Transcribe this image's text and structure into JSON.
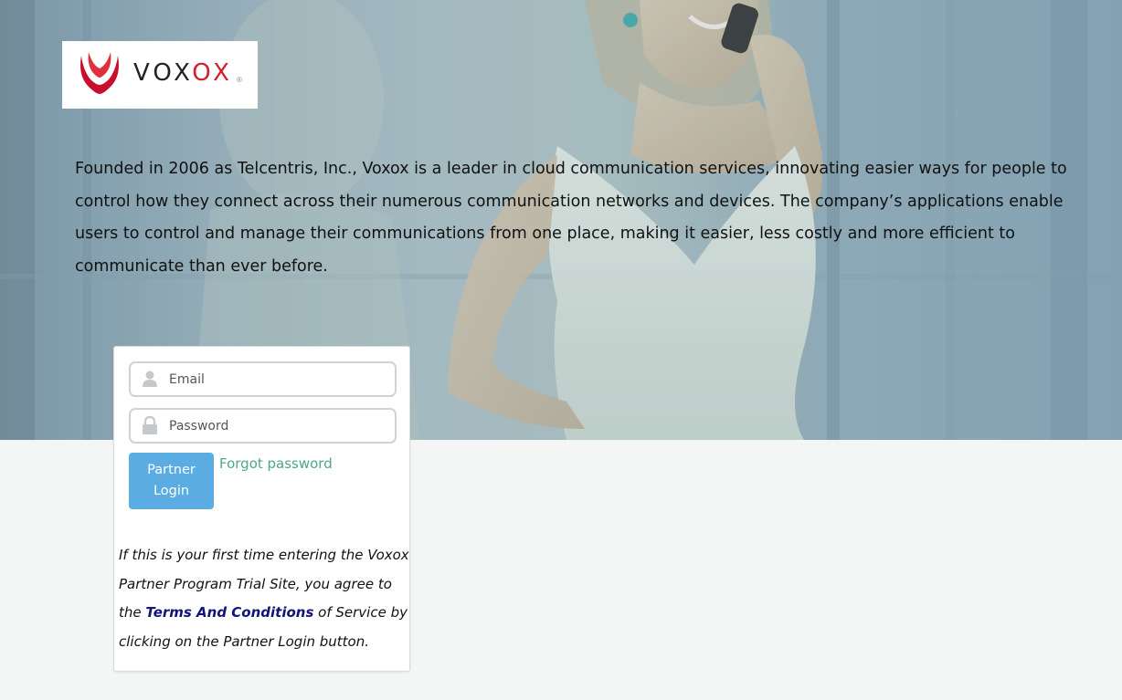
{
  "brand": {
    "name_part1": "VOX",
    "name_part2": "OX",
    "registered": "®"
  },
  "intro_text": "Founded in 2006 as Telcentris, Inc., Voxox is a leader in cloud communication services, innovating easier ways for people to control how they connect across their numerous communication networks and devices. The company’s applications enable users to control and manage their communications from one place, making it easier, less costly and more efficient to communicate than ever before.",
  "login": {
    "email_placeholder": "Email",
    "password_placeholder": "Password",
    "button_label": "Partner Login",
    "forgot_label": "Forgot password"
  },
  "terms": {
    "before": "If this is your first time entering the Voxox Partner Program Trial Site, you agree to the ",
    "link": "Terms And Conditions",
    "after": " of Service by clicking on the Partner Login button."
  },
  "colors": {
    "brand_red": "#d21f2a",
    "login_button": "#5aace2",
    "forgot_link": "#4fa883",
    "terms_link": "#13137a"
  },
  "icons": [
    "user-icon",
    "lock-icon",
    "voxox-logo-icon"
  ]
}
